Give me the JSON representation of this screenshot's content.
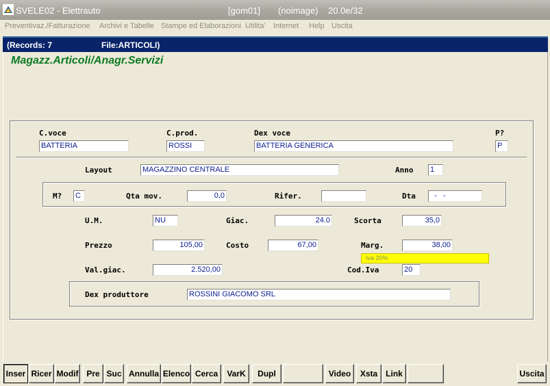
{
  "window": {
    "title": "SVELE02 - Elettrauto",
    "server": "[gom01]",
    "image": "(noimage)",
    "version": "20.0e/32"
  },
  "menu": [
    "Preventivaz./Fatturazione",
    "Archivi e Tabelle",
    "Stampe ed Elaborazioni",
    "Utilita'",
    "Internet",
    "Help",
    "Uscita"
  ],
  "header": {
    "records": "(Records: 7",
    "file": "File:ARTICOLI)"
  },
  "form_title": "Magazz.Articoli/Anagr.Servizi",
  "fields": {
    "cvoce": {
      "label": "C.voce",
      "value": "BATTERIA"
    },
    "cprod": {
      "label": "C.prod.",
      "value": "ROSSI"
    },
    "dexvoce": {
      "label": "Dex voce",
      "value": "BATTERIA GENERICA"
    },
    "p": {
      "label": "P?",
      "value": "P"
    },
    "layout": {
      "label": "Layout",
      "value": "MAGAZZINO CENTRALE"
    },
    "anno": {
      "label": "Anno",
      "value": "1"
    },
    "m": {
      "label": "M?",
      "value": "C"
    },
    "qtamov": {
      "label": "Qta mov.",
      "value": "0,0"
    },
    "rifer": {
      "label": "Rifer.",
      "value": ""
    },
    "dta": {
      "label": "Dta",
      "value": "  -   -"
    },
    "um": {
      "label": "U.M.",
      "value": "NU"
    },
    "giac": {
      "label": "Giac.",
      "value": "24.0"
    },
    "scorta": {
      "label": "Scorta",
      "value": "35,0"
    },
    "prezzo": {
      "label": "Prezzo",
      "value": "105,00"
    },
    "costo": {
      "label": "Costo",
      "value": "67,00"
    },
    "marg": {
      "label": "Marg.",
      "value": "38,00"
    },
    "valgiac": {
      "label": "Val.giac.",
      "value": "2.520,00"
    },
    "codiva": {
      "label": "Cod.Iva",
      "value": "20"
    },
    "dexprod": {
      "label": "Dex produttore",
      "value": "ROSSINI GIACOMO SRL"
    }
  },
  "iva_desc": "Iva 20%",
  "toolbar": [
    "Inser",
    "Ricer",
    "Modif",
    "Pre",
    "Suc",
    "Annulla",
    "Elenco",
    "Cerca",
    "VarK",
    "Dupl",
    "",
    "Video",
    "Xsta",
    "Link",
    "",
    "Uscita"
  ],
  "colors": {
    "title_green": "#0B7A22",
    "header_blue": "#0A246A",
    "field_text": "#0A1A8E",
    "iva_yellow": "#FFFF00"
  }
}
